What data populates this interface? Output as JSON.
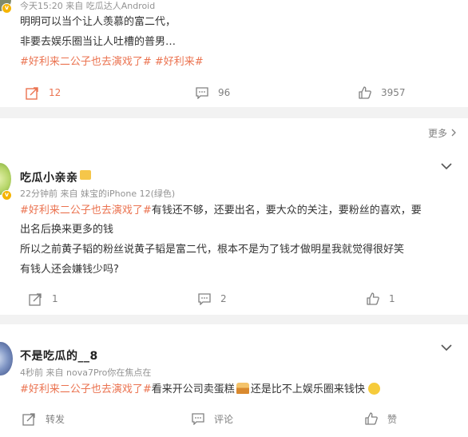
{
  "post1": {
    "meta": "今天15:20  来自 吃瓜达人Android",
    "lines": [
      "明明可以当个让人羡慕的富二代，",
      "非要去娱乐圈当让人吐槽的普男…"
    ],
    "tag_line": "#好利来二公子也去演戏了# #好利来#",
    "repost_count": "12",
    "comment_count": "96",
    "like_count": "3957"
  },
  "more": {
    "label": "更多"
  },
  "post2": {
    "nickname": "吃瓜小亲亲",
    "meta": "22分钟前  来自 妹宝的iPhone 12(绿色)",
    "tag": "#好利来二公子也去演戏了#",
    "line1_rest": "有钱还不够，还要出名，要大众的关注，要粉丝的喜欢，要",
    "line2": "出名后换来更多的钱",
    "line3": "所以之前黄子韬的粉丝说黄子韬是富二代，根本不是为了钱才做明星我就觉得很好笑",
    "line4": "有钱人还会嫌钱少吗?",
    "repost_count": "1",
    "comment_count": "2",
    "like_count": "1"
  },
  "post3": {
    "nickname": "不是吃瓜的__8",
    "meta": "4秒前  来自 nova7Pro你在焦点在",
    "tag": "#好利来二公子也去演戏了#",
    "line1_a": "看来开公司卖蛋糕",
    "line1_b": "还是比不上娱乐圈来钱快",
    "repost_label": "转发",
    "comment_label": "评论",
    "like_label": "赞"
  },
  "colors": {
    "tag": "#eb7350",
    "badge": "#f5b400",
    "background": "#f2f2f2"
  },
  "icons": [
    "repost-icon",
    "comment-icon",
    "like-icon",
    "chevron-down-icon",
    "chevron-right-icon",
    "verified-badge-icon",
    "cake-emoji-icon",
    "smile-emoji-icon"
  ]
}
